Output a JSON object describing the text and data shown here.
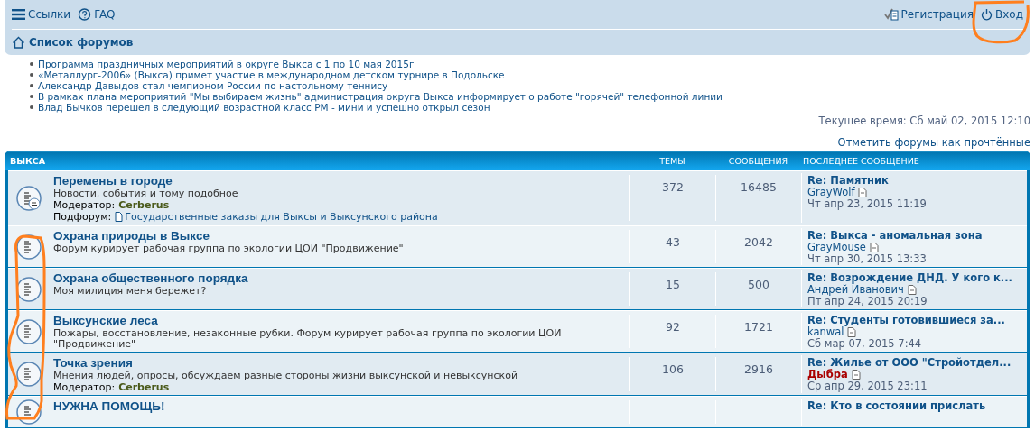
{
  "navbar": {
    "left_links": [
      {
        "kind": "menu",
        "label": "Ссылки"
      },
      {
        "kind": "faq",
        "label": "FAQ"
      }
    ],
    "right_links": [
      {
        "kind": "register",
        "label": "Регистрация"
      },
      {
        "kind": "login",
        "label": "Вход"
      }
    ],
    "breadcrumb": "Список форумов"
  },
  "news": [
    "Программа праздничных мероприятий в округе Выкса с 1 по 10 мая 2015г",
    "«Металлург-2006» (Выкса) примет участие в международном детском турнире в Подольске",
    "Александр Давыдов стал чемпионом России по настольному теннису",
    "В рамках плана мероприятий \"Мы выбираем жизнь\" администрация округа Выкса информирует о работе \"горячей\" телефонной линии",
    "Влад Бычков перешел в следующий возрастной класс РМ - мини и успешно открыл сезон"
  ],
  "current_time": "Текущее время: Сб май 02, 2015 12:10",
  "mark_read": "Отметить форумы как прочтённые",
  "forum_table": {
    "columns": [
      "ВЫКСА",
      "ТЕМЫ",
      "СООБЩЕНИЯ",
      "ПОСЛЕДНЕЕ СООБЩЕНИЕ"
    ],
    "rows": [
      {
        "title": "Перемены в городе",
        "description": "Новости, события и тому подобное",
        "has_subforum_icon": true,
        "moderator_label": "Модератор:",
        "moderator": "Cerberus",
        "subforum_label": "Подфорум:",
        "subforum": "Государственные заказы для Выксы и Выксунского района",
        "topics": "372",
        "posts": "16485",
        "last_post": {
          "title": "Re: Памятник",
          "author": "GrayWolf",
          "color": "#105289",
          "date": "Чт апр 23, 2015 11:19"
        }
      },
      {
        "title": "Охрана природы в Выксе",
        "description": "Форум курирует рабочая группа по экологии ЦОИ \"Продвижение\"",
        "has_subforum_icon": false,
        "topics": "43",
        "posts": "2042",
        "last_post": {
          "title": "Re: Выкса - аномальная зона",
          "author": "GrayMouse",
          "color": "#105289",
          "date": "Чт апр 30, 2015 13:33"
        }
      },
      {
        "title": "Охрана общественного порядка",
        "description": "Моя милиция меня бережет?",
        "has_subforum_icon": false,
        "topics": "15",
        "posts": "500",
        "last_post": {
          "title": "Re: Возрождение ДНД. У кого к...",
          "author": "Андрей Иванович",
          "color": "#105289",
          "date": "Пт апр 24, 2015 20:19"
        }
      },
      {
        "title": "Выксунские леса",
        "description": "Пожары, восстановление, незаконные рубки. Форум курирует рабочая группа по экологии ЦОИ \"Продвижение\"",
        "has_subforum_icon": false,
        "topics": "92",
        "posts": "1721",
        "last_post": {
          "title": "Re: Студенты готовившиеся за...",
          "author": "kanwal",
          "color": "#105289",
          "date": "Сб мар 07, 2015 7:44"
        }
      },
      {
        "title": "Точка зрения",
        "description": "Мнения людей, опросы, обсуждаем разные стороны жизни выксунской и невыксунской",
        "has_subforum_icon": false,
        "moderator_label": "Модератор:",
        "moderator": "Cerberus",
        "topics": "106",
        "posts": "2916",
        "last_post": {
          "title": "Re: Жилье от ООО \"Стройотдел...",
          "author": "Дыбра",
          "color": "#aa0000",
          "date": "Ср апр 29, 2015 23:11"
        }
      },
      {
        "title": "НУЖНА ПОМОЩЬ!",
        "has_subforum_icon": false,
        "last_post": {
          "title": "Re: Кто в состоянии прислать"
        }
      }
    ]
  }
}
